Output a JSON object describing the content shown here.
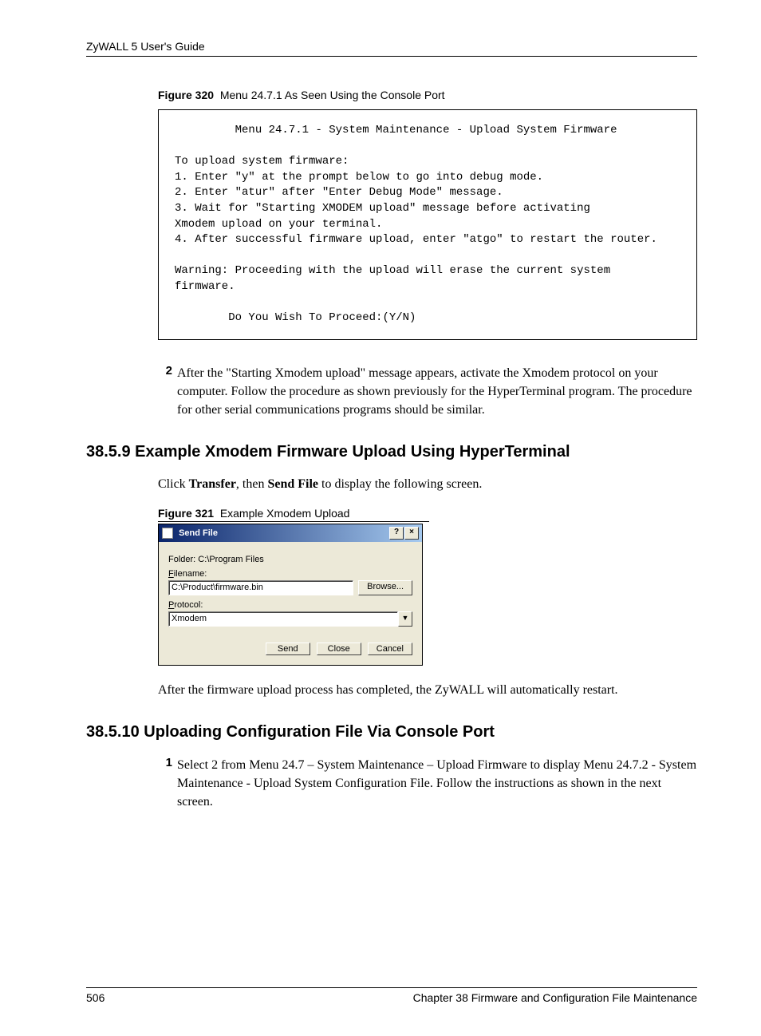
{
  "header": {
    "left": "ZyWALL 5 User's Guide"
  },
  "figure320": {
    "label_prefix": "Figure 320",
    "label_text": "Menu 24.7.1 As Seen Using the Console Port",
    "console": "         Menu 24.7.1 - System Maintenance - Upload System Firmware\n\nTo upload system firmware:\n1. Enter \"y\" at the prompt below to go into debug mode.\n2. Enter \"atur\" after \"Enter Debug Mode\" message.\n3. Wait for \"Starting XMODEM upload\" message before activating\nXmodem upload on your terminal.\n4. After successful firmware upload, enter \"atgo\" to restart the router.\n\nWarning: Proceeding with the upload will erase the current system\nfirmware.\n\n        Do You Wish To Proceed:(Y/N)"
  },
  "step2": {
    "num": "2",
    "text": "After the \"Starting Xmodem upload\" message appears, activate the Xmodem protocol on your computer. Follow the procedure as shown previously for the HyperTerminal program. The procedure for other serial communications programs should be similar."
  },
  "section_3859": {
    "heading": "38.5.9  Example Xmodem Firmware Upload Using HyperTerminal",
    "intro_pre": "Click ",
    "intro_b1": "Transfer",
    "intro_mid": ", then ",
    "intro_b2": "Send File",
    "intro_post": " to display the following screen."
  },
  "figure321": {
    "label_prefix": "Figure 321",
    "label_text": "Example Xmodem Upload"
  },
  "dialog": {
    "title": "Send File",
    "help_btn": "?",
    "close_btn": "×",
    "folder_label": "Folder: C:\\Program Files",
    "filename_label_u": "F",
    "filename_label_rest": "ilename:",
    "filename_value": "C:\\Product\\firmware.bin",
    "browse_u": "B",
    "browse_rest": "rowse...",
    "protocol_u": "P",
    "protocol_rest": "rotocol:",
    "protocol_value": "Xmodem",
    "send_u": "S",
    "send_rest": "end",
    "close_u2": "C",
    "close_rest": "lose",
    "cancel": "Cancel"
  },
  "after_upload": "After the firmware upload process has completed, the ZyWALL will automatically restart.",
  "section_38510": {
    "heading": "38.5.10  Uploading Configuration File Via Console Port",
    "step_num": "1",
    "step_text": "Select 2 from Menu 24.7 – System Maintenance – Upload Firmware to display Menu 24.7.2 - System Maintenance - Upload System Configuration File. Follow the instructions as shown in the next screen."
  },
  "footer": {
    "page_no": "506",
    "chapter": "Chapter 38 Firmware and Configuration File Maintenance"
  }
}
